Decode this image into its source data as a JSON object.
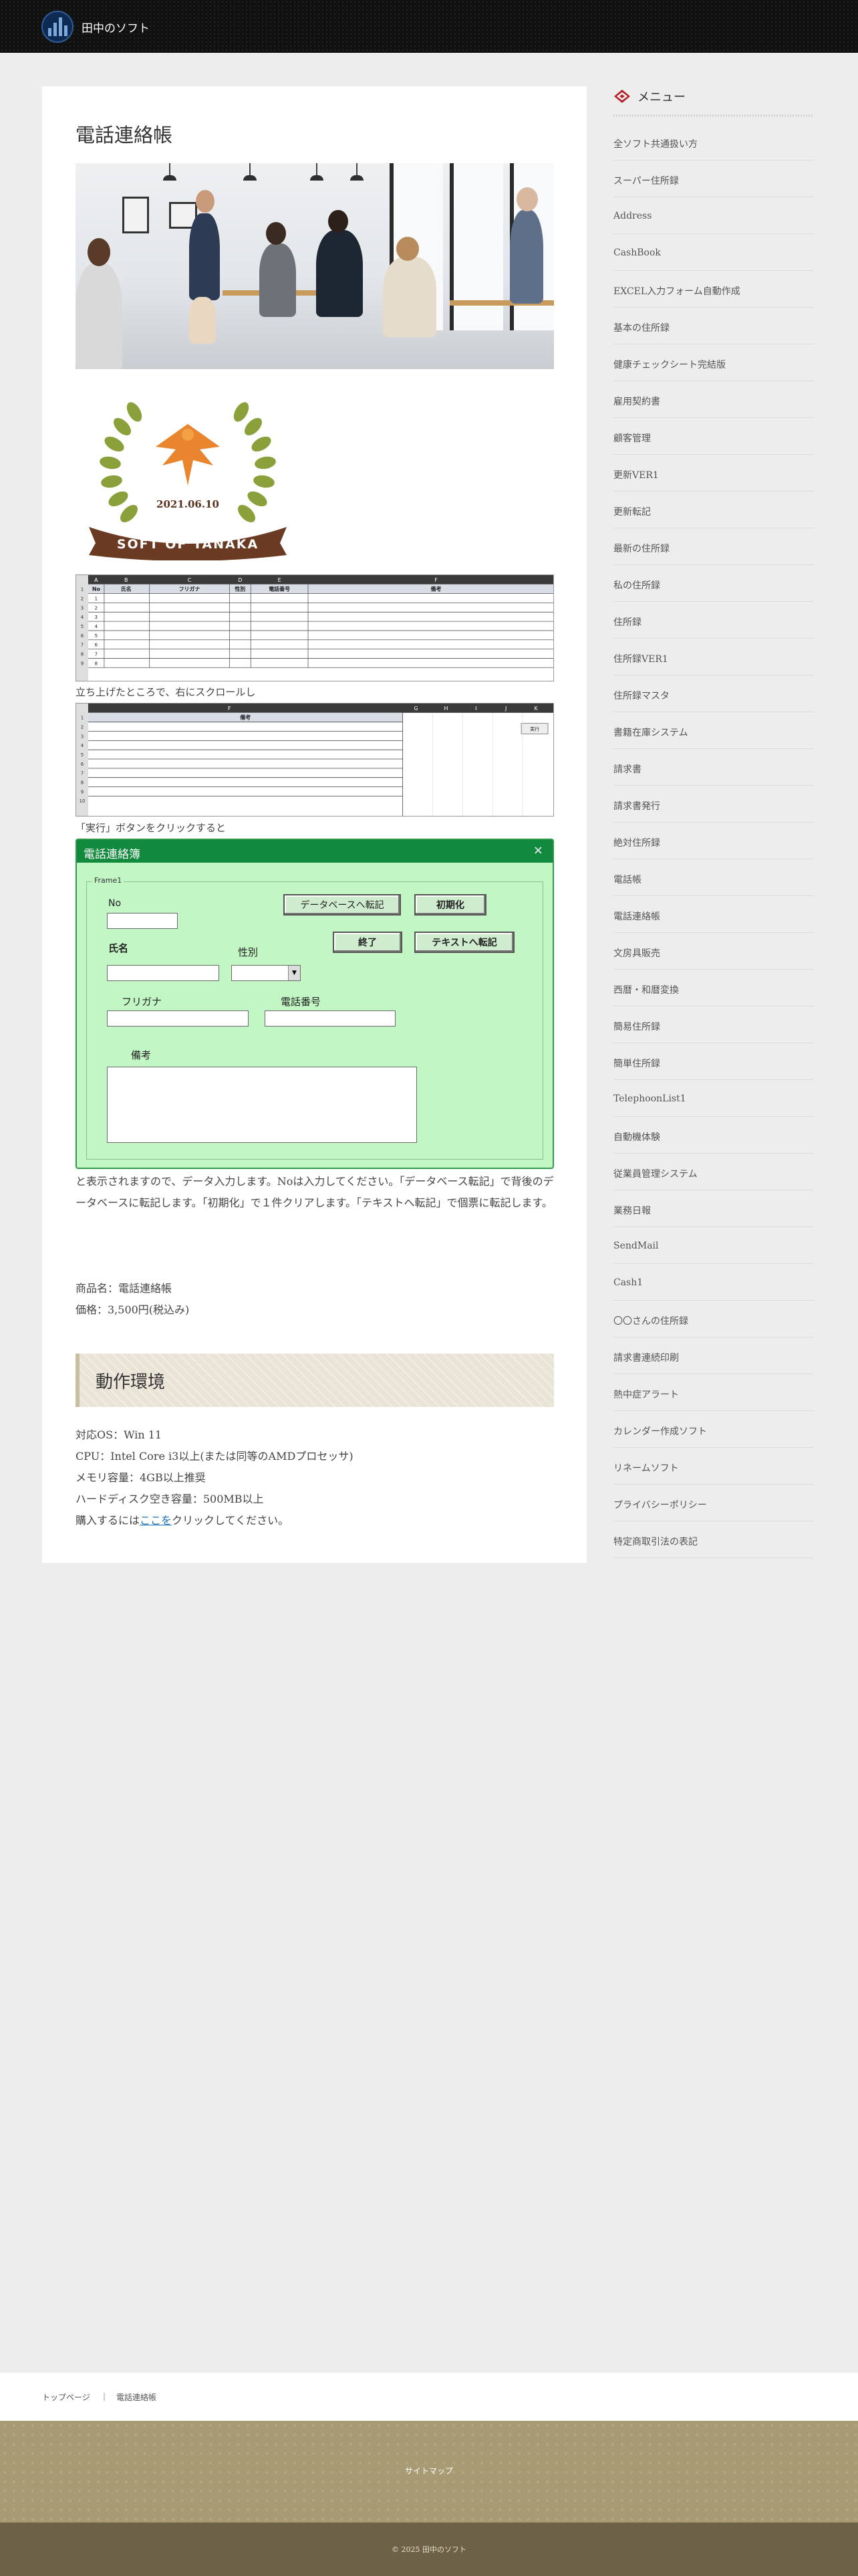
{
  "header": {
    "site_name": "田中のソフト"
  },
  "article": {
    "title": "電話連絡帳",
    "emblem": {
      "date": "2021.06.10",
      "ribbon_text": "SOFT OF TANAKA"
    },
    "sheet1": {
      "col_letters": [
        "A",
        "B",
        "C",
        "D",
        "E",
        "F"
      ],
      "headers": [
        "No",
        "氏名",
        "フリガナ",
        "性別",
        "電話番号",
        "備考"
      ],
      "row_numbers": [
        "1",
        "2",
        "3",
        "4",
        "5",
        "6",
        "7",
        "8",
        "9"
      ],
      "nos": [
        "1",
        "2",
        "3",
        "4",
        "5",
        "6",
        "7",
        "8"
      ]
    },
    "caption_scroll": "立ち上げたところで、右にスクロールし",
    "sheet2": {
      "col_letters": [
        "F",
        "G",
        "H",
        "I",
        "J",
        "K"
      ],
      "header": "備考",
      "button": "実行",
      "row_numbers": [
        "1",
        "2",
        "3",
        "4",
        "5",
        "6",
        "7",
        "8",
        "9",
        "10"
      ]
    },
    "caption_run": "「実行」ボタンをクリックすると",
    "dialog": {
      "title": "電話連絡簿",
      "close": "×",
      "frame_label": "Frame1",
      "labels": {
        "no": "No",
        "name": "氏名",
        "gender": "性別",
        "furigana": "フリガナ",
        "phone": "電話番号",
        "memo": "備考"
      },
      "buttons": {
        "db_transfer": "データベースへ転記",
        "initialize": "初期化",
        "exit": "終了",
        "text_transfer": "テキストへ転記"
      }
    },
    "description": "と表示されますので、データ入力します。Noは入力してください。「データベース転記」で背後のデータベースに転記します。「初期化」で１件クリアします。「テキストへ転記」で個票に転記します。",
    "product_name": "商品名：電話連絡帳",
    "product_price": "価格：3,500円(税込み)",
    "env_heading": "動作環境",
    "env": {
      "os": "対応OS：Win 11",
      "cpu": "CPU：Intel Core i3以上(または同等のAMDプロセッサ)",
      "memory": "メモリ容量：4GB以上推奨",
      "disk": "ハードディスク空き容量：500MB以上",
      "purchase_prefix": "購入するには",
      "purchase_link": "ここを",
      "purchase_suffix": "クリックしてください。"
    }
  },
  "sidebar": {
    "title": "メニュー",
    "items": [
      "全ソフト共通扱い方",
      "スーパー住所録",
      "Address",
      "CashBook",
      "EXCEL入力フォーム自動作成",
      "基本の住所録",
      "健康チェックシート完結版",
      "雇用契約書",
      "顧客管理",
      "更新VER1",
      "更新転記",
      "最新の住所録",
      "私の住所録",
      "住所録",
      "住所録VER1",
      "住所録マスタ",
      "書籍在庫システム",
      "請求書",
      "請求書発行",
      "絶対住所録",
      "電話帳",
      "電話連絡帳",
      "文房具販売",
      "西暦・和暦変換",
      "簡易住所録",
      "簡単住所録",
      "TelephoonList1",
      "自動機体験",
      "従業員管理システム",
      "業務日報",
      "SendMail",
      "Cash1",
      "〇〇さんの住所録",
      "請求書連続印刷",
      "熱中症アラート",
      "カレンダー作成ソフト",
      "リネームソフト",
      "プライバシーポリシー",
      "特定商取引法の表記"
    ]
  },
  "breadcrumb": {
    "home": "トップページ",
    "separator": "|",
    "current": "電話連絡帳"
  },
  "footer": {
    "sitemap": "サイトマップ",
    "copyright": "© 2025 田中のソフト"
  }
}
